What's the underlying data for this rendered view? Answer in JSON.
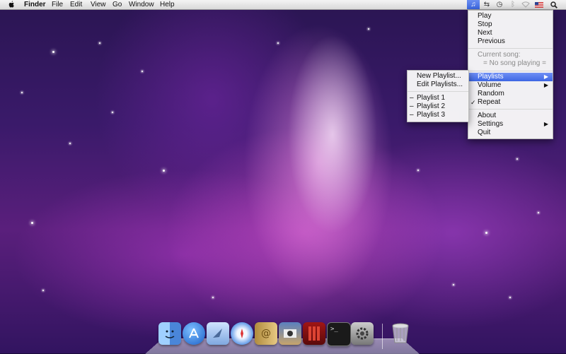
{
  "menubar": {
    "app_name": "Finder",
    "menus": [
      "File",
      "Edit",
      "View",
      "Go",
      "Window",
      "Help"
    ],
    "status_icons": [
      "music-note-icon",
      "sync-arrows-icon",
      "time-machine-icon",
      "bluetooth-icon",
      "wifi-icon",
      "us-flag-icon",
      "spotlight-icon"
    ]
  },
  "main_menu": {
    "items": [
      {
        "label": "Play"
      },
      {
        "label": "Stop"
      },
      {
        "label": "Next"
      },
      {
        "label": "Previous"
      }
    ],
    "current_song_label": "Current song:",
    "current_song_value": "= No song playing =",
    "items2": [
      {
        "label": "Playlists",
        "submenu": true,
        "selected": true
      },
      {
        "label": "Volume",
        "submenu": true
      },
      {
        "label": "Random"
      },
      {
        "label": "Repeat",
        "checked": true
      }
    ],
    "items3": [
      {
        "label": "About"
      },
      {
        "label": "Settings",
        "submenu": true
      },
      {
        "label": "Quit"
      }
    ]
  },
  "playlists_menu": {
    "actions": [
      {
        "label": "New Playlist..."
      },
      {
        "label": "Edit Playlists..."
      }
    ],
    "playlists": [
      {
        "label": "Playlist 1"
      },
      {
        "label": "Playlist 2"
      },
      {
        "label": "Playlist 3"
      }
    ]
  },
  "dock": {
    "apps": [
      "finder-icon",
      "app-store-icon",
      "mail-icon",
      "safari-icon",
      "address-book-icon",
      "photo-booth-icon",
      "front-row-icon",
      "terminal-icon",
      "system-preferences-icon",
      "trash-icon"
    ]
  },
  "colors": {
    "selection": "#3d66e3",
    "menubar": "#e6e6e6"
  }
}
